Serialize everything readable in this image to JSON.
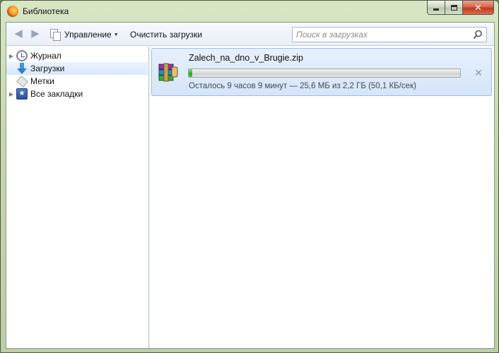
{
  "window": {
    "title": "Библиотека",
    "close_glyph": "✕"
  },
  "toolbar": {
    "back_glyph": "◀",
    "forward_glyph": "▶",
    "organize_label": "Управление",
    "organize_caret": "▼",
    "clear_downloads_label": "Очистить загрузки",
    "search_placeholder": "Поиск в загрузках",
    "search_value": ""
  },
  "sidebar": {
    "items": [
      {
        "label": "Журнал",
        "icon": "history-icon",
        "expandable": true,
        "selected": false
      },
      {
        "label": "Загрузки",
        "icon": "download-arrow-icon",
        "expandable": false,
        "selected": true
      },
      {
        "label": "Метки",
        "icon": "tag-icon",
        "expandable": false,
        "selected": false
      },
      {
        "label": "Все закладки",
        "icon": "bookmarks-star-icon",
        "expandable": true,
        "selected": false
      }
    ],
    "twisty_glyph": "▶",
    "bookmarks_icon_glyph": "★"
  },
  "downloads": [
    {
      "file_name": "Zalech_na_dno_v_Brugie.zip",
      "status": "Осталось 9 часов 9 минут — 25,6 МБ из 2,2 ГБ (50,1 КБ/сек)",
      "progress_fraction": 0.012,
      "icon": "winrar-archive-icon",
      "cancel_glyph": "✕"
    }
  ],
  "colors": {
    "accent": "#3f95e0",
    "progress": "#2ebc2a",
    "selected_row": "#d7e8fb"
  }
}
